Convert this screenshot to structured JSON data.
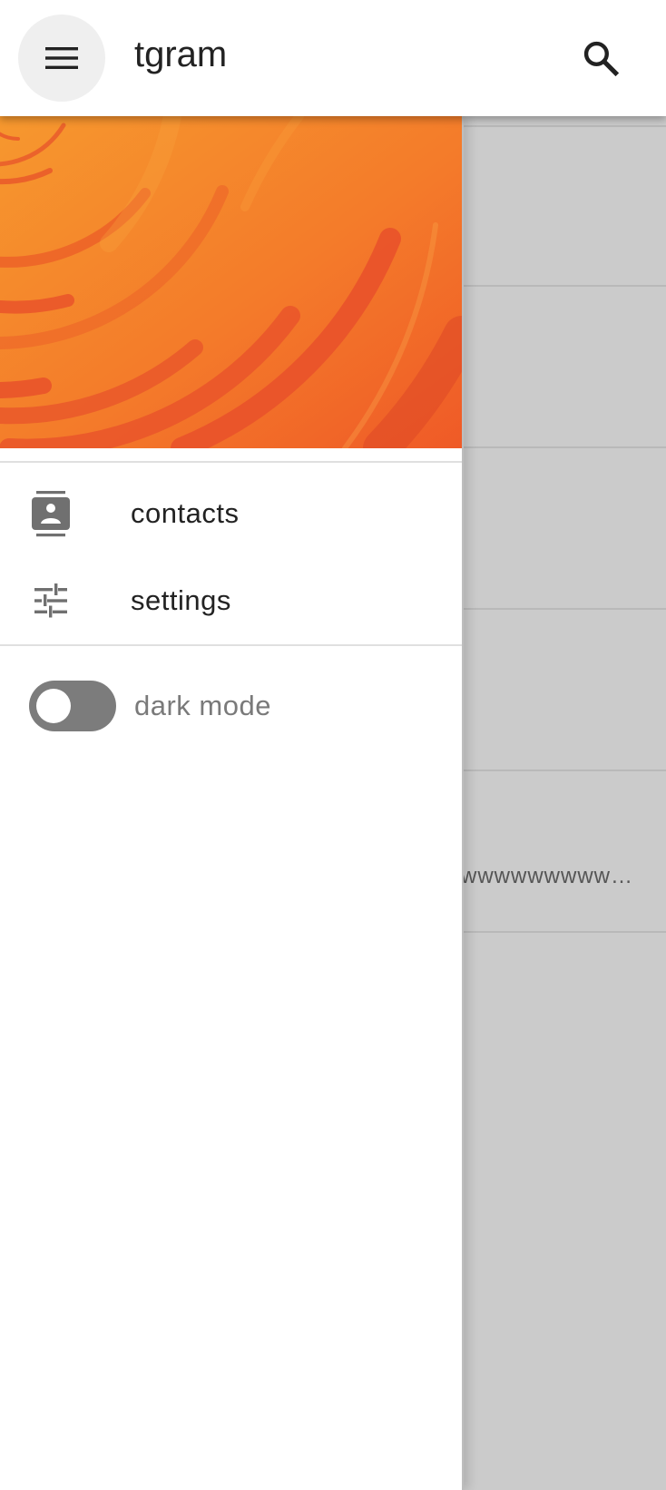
{
  "appbar": {
    "title": "tgram",
    "menu_icon": "hamburger-menu-icon",
    "search_icon": "search-icon"
  },
  "drawer": {
    "header_image": "orange-abstract-swirl-banner",
    "items": [
      {
        "label": "contacts",
        "icon": "contacts-icon"
      },
      {
        "label": "settings",
        "icon": "tune-sliders-icon"
      }
    ],
    "dark_mode": {
      "label": "dark mode",
      "enabled": false
    }
  },
  "chat_list": {
    "previews": [
      "",
      "",
      "",
      "",
      "wwwwwwwwwwwwwwwwwwwwww"
    ]
  },
  "colors": {
    "accent_orange": "#f47b2a",
    "toggle_off": "#7c7c7c"
  }
}
